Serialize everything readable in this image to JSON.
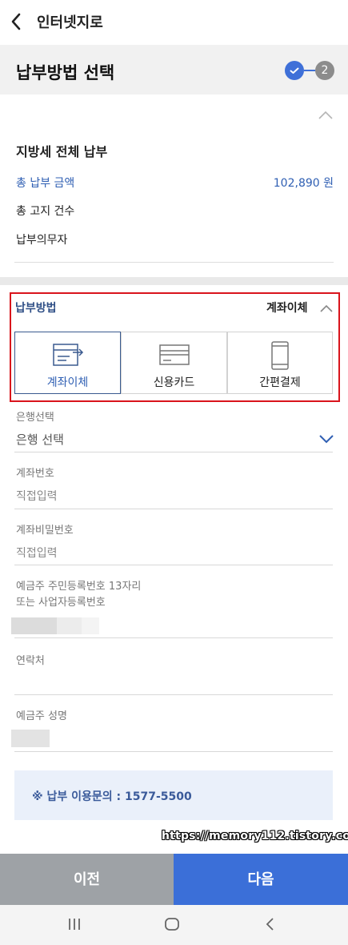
{
  "topbar": {
    "title": "인터넷지로",
    "back_icon": "chevron-left-icon"
  },
  "step": {
    "title": "납부방법 선택",
    "step1_icon": "check-icon",
    "step2_label": "2",
    "active_color": "#3f70d8",
    "inactive_color": "#8c8c8c"
  },
  "summary": {
    "title": "지방세 전체 납부",
    "total_amount_label": "총 납부 금액",
    "total_amount_value": "102,890 원",
    "notice_count_label": "총 고지 건수",
    "payer_label": "납부의무자"
  },
  "payment_method": {
    "label": "납부방법",
    "selected": "계좌이체",
    "options": [
      {
        "label": "계좌이체",
        "icon": "bank-transfer-icon",
        "active": true
      },
      {
        "label": "신용카드",
        "icon": "credit-card-icon",
        "active": false
      },
      {
        "label": "간편결제",
        "icon": "mobile-phone-icon",
        "active": false
      }
    ]
  },
  "form": {
    "bank": {
      "label": "은행선택",
      "value": "은행 선택"
    },
    "account_number": {
      "label": "계좌번호",
      "placeholder": "직접입력"
    },
    "account_password": {
      "label": "계좌비밀번호",
      "placeholder": "직접입력"
    },
    "resident_id": {
      "label_line1": "예금주 주민등록번호 13자리",
      "label_line2": "또는 사업자등록번호"
    },
    "contact": {
      "label": "연락처"
    },
    "holder_name": {
      "label": "예금주 성명"
    }
  },
  "info": {
    "text": "※ 납부 이용문의 : 1577-5500"
  },
  "watermark": "https://memory112.tistory.com",
  "buttons": {
    "prev": "이전",
    "next": "다음"
  },
  "navbar": {
    "recents_icon": "recent-apps-icon",
    "home_icon": "home-icon",
    "back_icon": "back-icon"
  },
  "colors": {
    "accent": "#3b6fd8",
    "highlight_border": "#d9141c",
    "link_blue": "#2f5fb3"
  }
}
